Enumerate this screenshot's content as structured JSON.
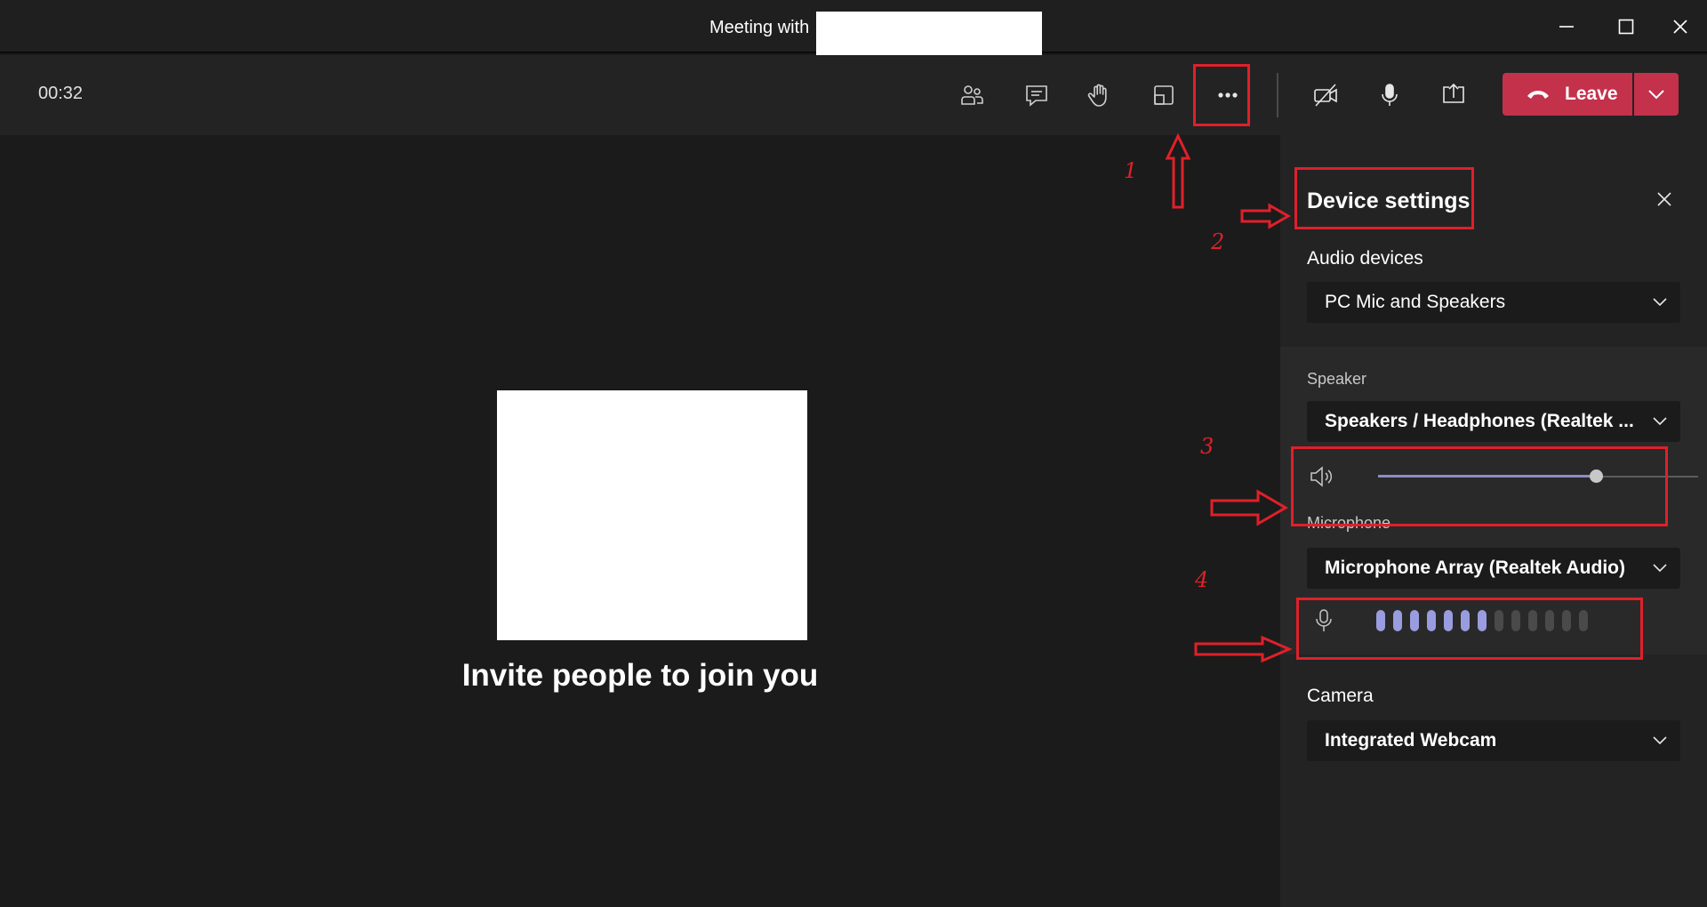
{
  "window": {
    "title": "Meeting with",
    "controls": [
      "minimize-icon",
      "maximize-icon",
      "close-icon"
    ]
  },
  "toolbar": {
    "timer": "00:32",
    "buttons": [
      "people-icon",
      "chat-icon",
      "raise-hand-icon",
      "rooms-icon",
      "more-options-icon",
      "camera-off-icon",
      "microphone-icon",
      "share-icon"
    ],
    "leave_label": "Leave"
  },
  "stage": {
    "invite_text": "Invite people to join you"
  },
  "device_settings": {
    "title": "Device settings",
    "audio_devices_label": "Audio devices",
    "audio_devices_value": "PC Mic and Speakers",
    "speaker_label": "Speaker",
    "speaker_value": "Speakers / Headphones (Realtek ...",
    "speaker_volume": 0.68,
    "microphone_label": "Microphone",
    "microphone_value": "Microphone Array (Realtek Audio)",
    "mic_level_active": 7,
    "mic_level_total": 13,
    "camera_label": "Camera",
    "camera_value": "Integrated Webcam"
  },
  "annotations": [
    "1",
    "2",
    "3",
    "4"
  ],
  "colors": {
    "leave": "#c4314b",
    "accent": "#8b8cc7",
    "annotation": "#e0202a"
  }
}
